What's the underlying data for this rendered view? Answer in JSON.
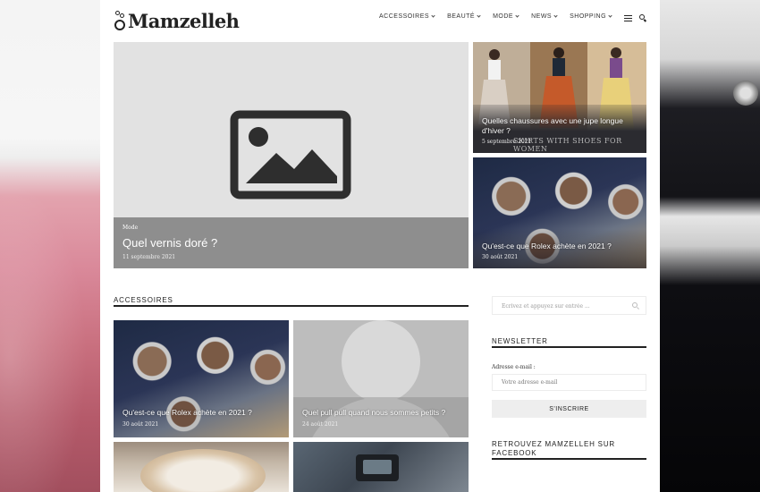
{
  "site": {
    "logo_text": "Mamzelleh"
  },
  "nav": {
    "items": [
      {
        "label": "ACCESSOIRES"
      },
      {
        "label": "BEAUTÉ"
      },
      {
        "label": "MODE"
      },
      {
        "label": "NEWS"
      },
      {
        "label": "SHOPPING"
      }
    ]
  },
  "hero": {
    "category": "Mode",
    "title": "Quel vernis doré ?",
    "date": "11 septembre 2021"
  },
  "side_posts": [
    {
      "title": "Quelles chaussures avec une jupe longue d'hiver ?",
      "date": "5 septembre 2021",
      "banner": "SKIRTS WITH SHOES FOR WOMEN"
    },
    {
      "title": "Qu'est-ce que Rolex achète en 2021 ?",
      "date": "30 août 2021"
    }
  ],
  "section": {
    "title": "ACCESSOIRES"
  },
  "grid_posts": [
    {
      "title": "Qu'est-ce que Rolex achète en 2021 ?",
      "date": "30 août 2021"
    },
    {
      "title": "Quel pull pull quand nous sommes petits ?",
      "date": "24 août 2021"
    }
  ],
  "sidebar": {
    "search_placeholder": "Écrivez et appuyez sur entrée ...",
    "newsletter": {
      "title": "NEWSLETTER",
      "email_label": "Adresse e-mail :",
      "email_placeholder": "Votre adresse e-mail",
      "button_label": "S'INSCRIRE"
    },
    "facebook_title": "RETROUVEZ MAMZELLEH SUR FACEBOOK"
  },
  "colors": {
    "accent": "#222222",
    "overlay": "#6e6e6e",
    "page_bg": "#ffffff"
  }
}
